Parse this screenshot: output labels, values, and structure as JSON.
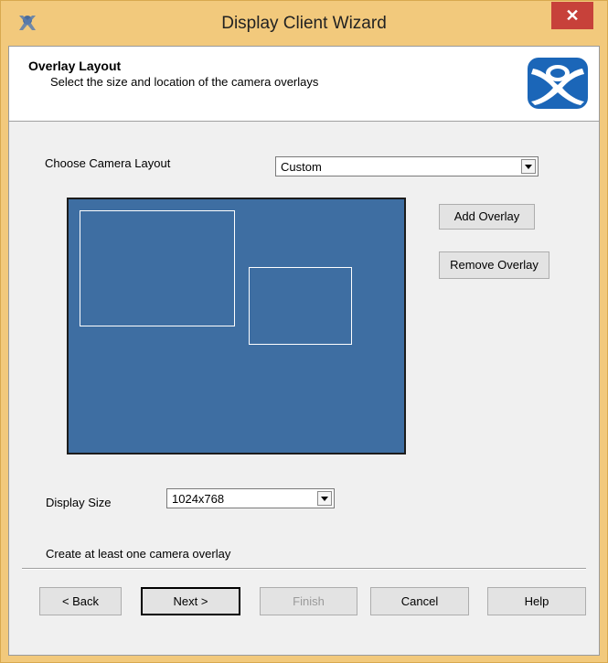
{
  "window": {
    "title": "Display Client Wizard",
    "close_glyph": "✕",
    "icon": "thinmanager-icon"
  },
  "header": {
    "title": "Overlay Layout",
    "subtitle": "Select the size and location of the camera overlays",
    "logo": "thinmanager-logo"
  },
  "layout": {
    "label": "Choose Camera Layout",
    "selected": "Custom"
  },
  "buttons": {
    "add_overlay": "Add Overlay",
    "remove_overlay": "Remove Overlay"
  },
  "display_size": {
    "label": "Display Size",
    "selected": "1024x768"
  },
  "status": "Create at least one camera overlay",
  "footer": {
    "back": "< Back",
    "next": "Next >",
    "finish": "Finish",
    "cancel": "Cancel",
    "help": "Help"
  },
  "colors": {
    "preview_bg": "#3e6ea2",
    "overlay_border": "#ffffff",
    "title_bar": "#f2c97c",
    "close_button": "#c7413a"
  }
}
